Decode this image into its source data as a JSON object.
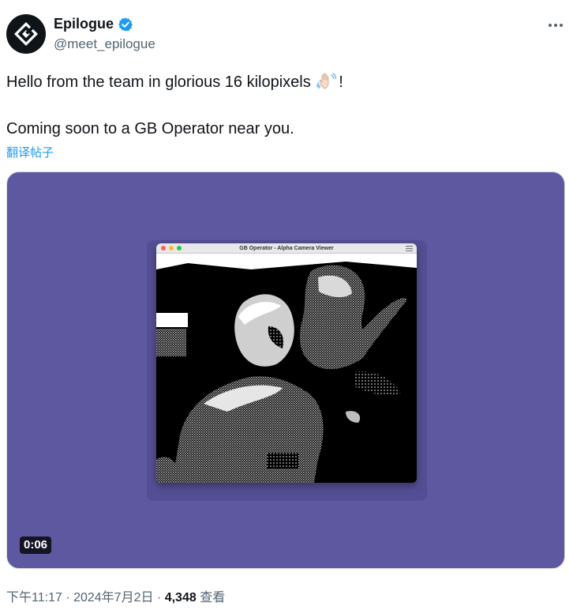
{
  "author": {
    "display_name": "Epilogue",
    "handle": "@meet_epilogue",
    "verified": true,
    "avatar_icon": "epilogue-logo-icon"
  },
  "tweet": {
    "line1_before": "Hello from the team in glorious 16 kilopixels ",
    "line1_emoji": "waving-hand-icon",
    "line1_after": "!",
    "line2": "Coming soon to a GB Operator near you.",
    "translate_label": "翻译帖子"
  },
  "media": {
    "background_color": "#5d58a0",
    "window_title": "GB Operator - Alpha Camera Viewer",
    "duration": "0:06"
  },
  "meta": {
    "time": "下午11:17",
    "separator": " · ",
    "date": "2024年7月2日",
    "views_count": "4,348",
    "views_label": " 查看"
  },
  "colors": {
    "accent": "#1d9bf0",
    "text_primary": "#0f1419",
    "text_secondary": "#536471"
  }
}
